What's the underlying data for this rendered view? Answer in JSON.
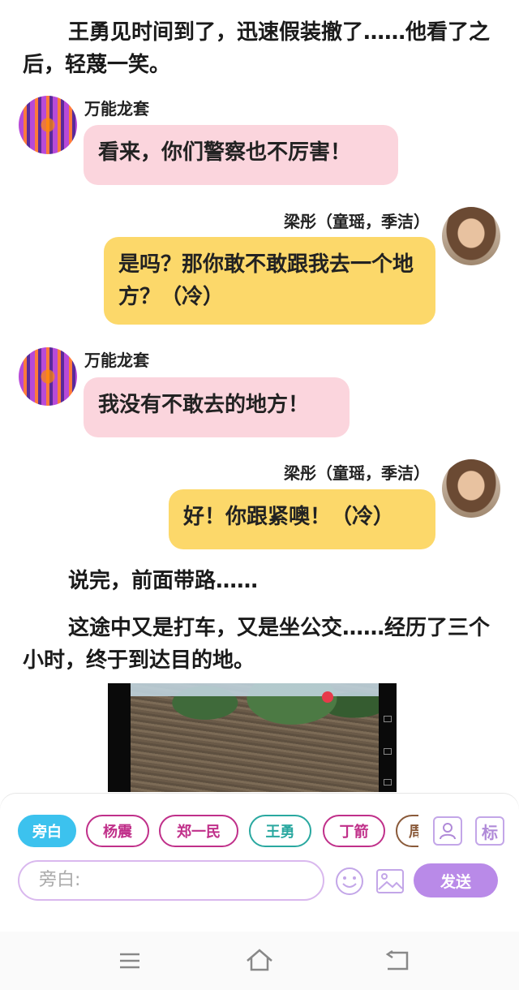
{
  "story": {
    "narration_1": "王勇见时间到了，迅速假装撤了……他看了之后，轻蔑一笑。",
    "narration_2": "说完，前面带路……",
    "narration_3": "这途中又是打车，又是坐公交……经历了三个小时，终于到达目的地。"
  },
  "messages": [
    {
      "sender": "万能龙套",
      "text": "看来，你们警察也不厉害！",
      "side": "left",
      "color": "#fbd5dd"
    },
    {
      "sender": "梁彤（童瑶，季洁）",
      "text": "是吗？那你敢不敢跟我去一个地方？（冷）",
      "side": "right",
      "color": "#fcd86a"
    },
    {
      "sender": "万能龙套",
      "text": "我没有不敢去的地方！",
      "side": "left",
      "color": "#fbd5dd"
    },
    {
      "sender": "梁彤（童瑶，季洁）",
      "text": "好！你跟紧噢！（冷）",
      "side": "right",
      "color": "#fcd86a"
    }
  ],
  "composer": {
    "chips": [
      {
        "label": "旁白",
        "color": "#3cc2ee",
        "filled": true
      },
      {
        "label": "杨震",
        "color": "#c0308a",
        "filled": false
      },
      {
        "label": "郑一民",
        "color": "#c0308a",
        "filled": false
      },
      {
        "label": "王勇",
        "color": "#2aa8a0",
        "filled": false
      },
      {
        "label": "丁箭",
        "color": "#c0308a",
        "filled": false
      },
      {
        "label": "周",
        "color": "#8a5a3a",
        "filled": false
      }
    ],
    "role_icon": "person-card-icon",
    "tag_label": "标",
    "input_placeholder": "旁白:",
    "emoji_icon": "smiley-icon",
    "image_icon": "image-icon",
    "send_label": "发送"
  },
  "navbar": {
    "icons": [
      "menu-icon",
      "home-icon",
      "back-icon"
    ]
  }
}
